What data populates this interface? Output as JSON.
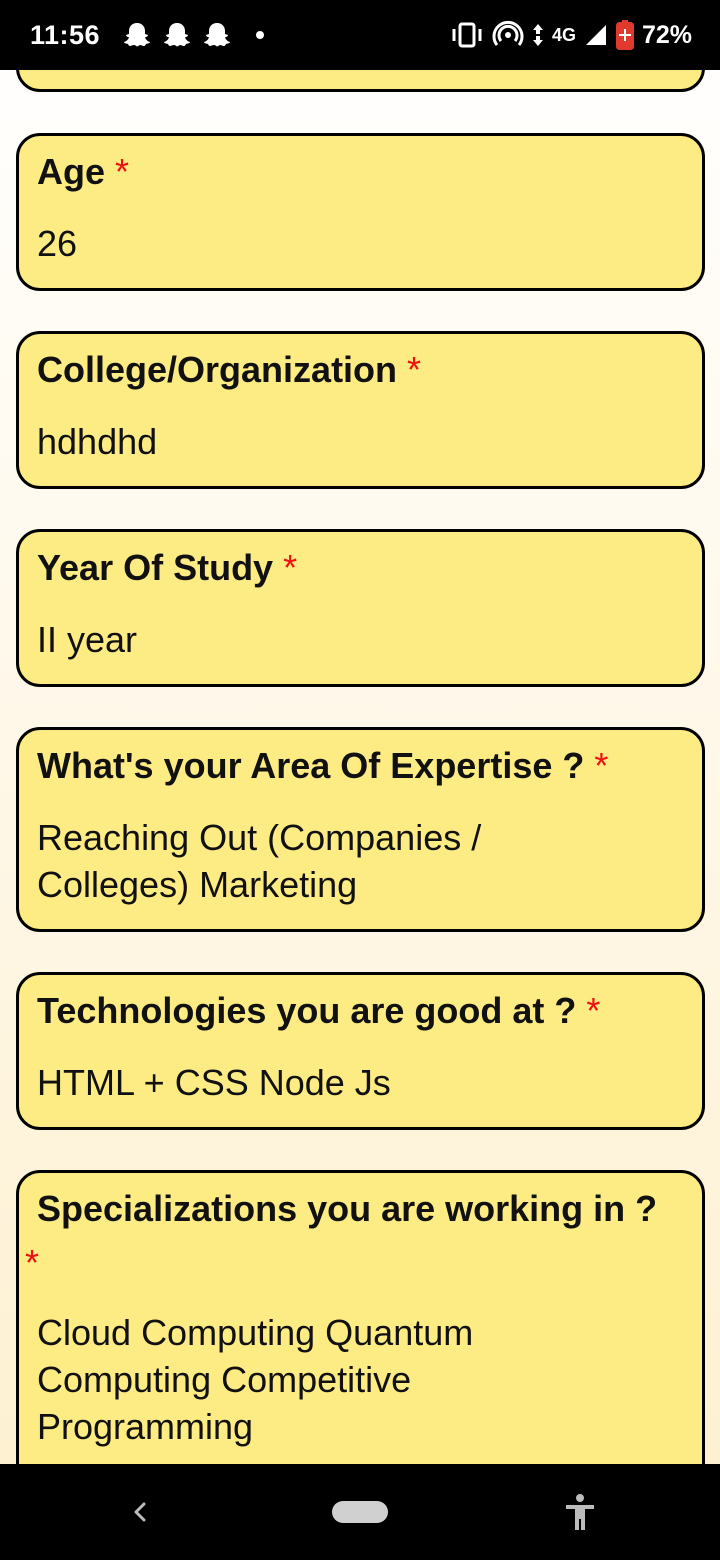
{
  "status_bar": {
    "time": "11:56",
    "network": "4G",
    "battery": "72%",
    "icons": [
      "snapchat-icon",
      "snapchat-icon",
      "snapchat-icon",
      "dot-icon",
      "vibrate-icon",
      "hotspot-icon",
      "data-arrows-icon",
      "signal-icon",
      "battery-saver-icon"
    ]
  },
  "form": {
    "required_mark": "*",
    "fields": [
      {
        "label": "Age",
        "value": "26"
      },
      {
        "label": "College/Organization",
        "value": "hdhdhd"
      },
      {
        "label": "Year Of Study",
        "value": "II year"
      },
      {
        "label": "What's your Area Of Expertise ?",
        "value": "Reaching Out (Companies / Colleges)  Marketing"
      },
      {
        "label": "Technologies you are good at ?",
        "value": "HTML + CSS  Node Js"
      },
      {
        "label": "Specializations you are working in ?",
        "value": "Cloud Computing  Quantum Computing  Competitive Programming"
      }
    ]
  },
  "colors": {
    "card_background": "#fdeb84",
    "card_border": "#000000",
    "required": "#ee1111"
  },
  "nav_bar": {
    "icons": [
      "back-icon",
      "home-pill",
      "accessibility-icon"
    ]
  }
}
